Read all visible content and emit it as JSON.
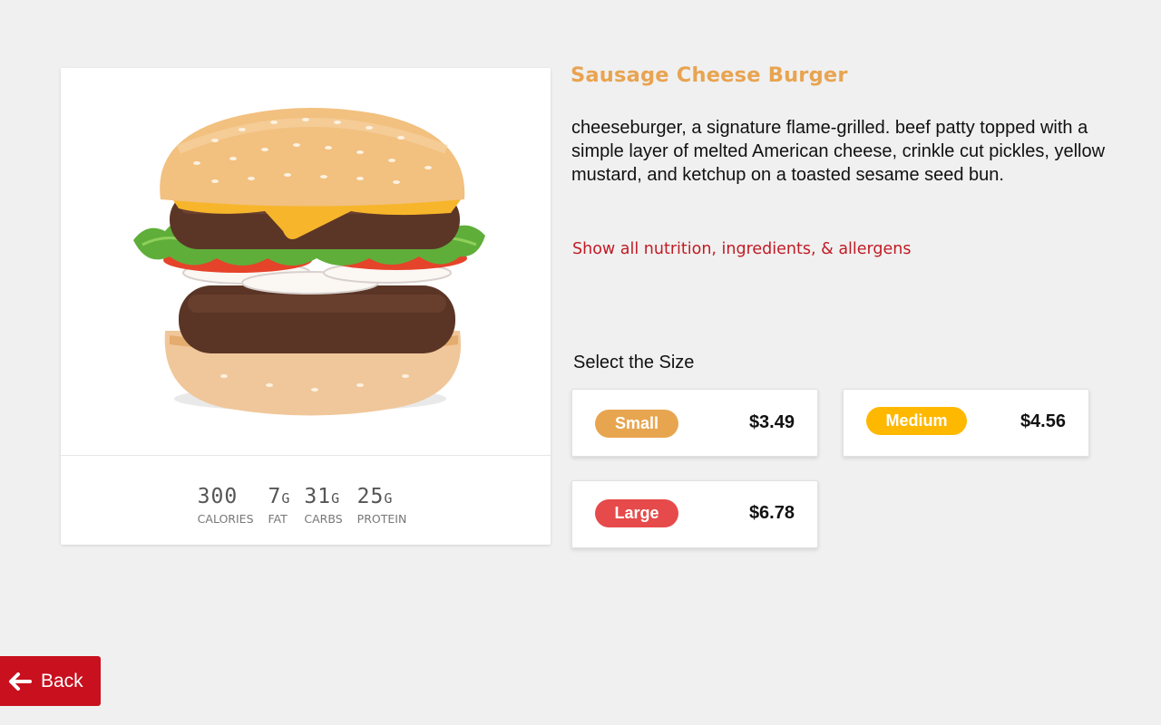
{
  "product": {
    "title": "Sausage Cheese Burger",
    "description": "cheeseburger, a signature flame-grilled. beef patty topped with a simple layer of melted American cheese, crinkle cut pickles, yellow mustard, and ketchup on a toasted sesame seed bun.",
    "image_icon": "burger-image"
  },
  "nutrition": {
    "calories": {
      "value": "300",
      "unit": "",
      "label": "CALORIES"
    },
    "fat": {
      "value": "7",
      "unit": "G",
      "label": "FAT"
    },
    "carbs": {
      "value": "31",
      "unit": "G",
      "label": "CARBS"
    },
    "protein": {
      "value": "25",
      "unit": "G",
      "label": "PROTEIN"
    }
  },
  "nutrition_link": "Show all nutrition, ingredients, & allergens",
  "size_heading": "Select the Size",
  "sizes": [
    {
      "label": "Small",
      "price": "$3.49",
      "color": "#e8a54f"
    },
    {
      "label": "Medium",
      "price": "$4.56",
      "color": "#ffb800"
    },
    {
      "label": "Large",
      "price": "$6.78",
      "color": "#e64a4a"
    }
  ],
  "back_button": {
    "label": "Back",
    "icon": "arrow-left-icon",
    "color": "#c8101e"
  },
  "colors": {
    "background": "#f0f0f0",
    "title_accent": "#e8a451",
    "link": "#c11b24"
  }
}
